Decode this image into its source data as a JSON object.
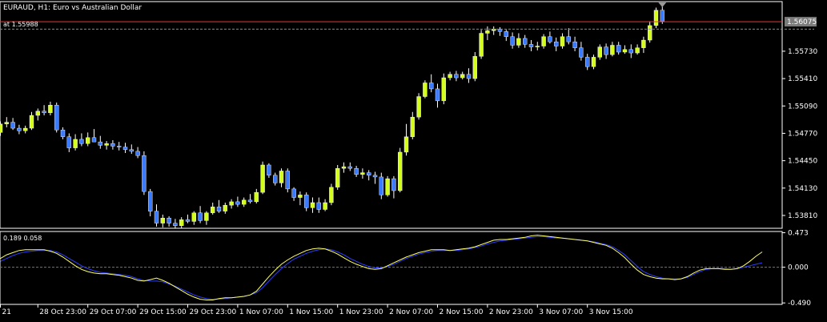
{
  "window": {
    "title": "EURAUD, H1:  Euro vs Australian Dollar",
    "alert_label": "at 1.55988"
  },
  "colors": {
    "background": "#000000",
    "bull": "#d4ff1c",
    "bear": "#3b7bff",
    "wick": "#ffffff",
    "axis": "#ffffff",
    "grid": "#777777",
    "alert_line": "#8a8a8a",
    "bid_line": "#ff2d2d",
    "price_tag_bg": "#7b7b7b",
    "osc_main": "#ffff66",
    "osc_signal": "#2d3dff"
  },
  "chart_data": [
    {
      "type": "candlestick",
      "title": "EURAUD, H1:  Euro vs Australian Dollar",
      "y_ticks": [
        1.5573,
        1.5541,
        1.5509,
        1.5477,
        1.5445,
        1.5413,
        1.5381
      ],
      "y_tick_labels": [
        "1.55730",
        "1.55410",
        "1.55090",
        "1.54770",
        "1.54450",
        "1.54130",
        "1.53810"
      ],
      "ylim": [
        1.5366,
        1.5631
      ],
      "current_price": 1.56075,
      "current_price_label": "1.56075",
      "alert_price": 1.55988,
      "x_ticks": [
        {
          "index": 0,
          "label": "21"
        },
        {
          "index": 6,
          "label": "28 Oct 23:00"
        },
        {
          "index": 14,
          "label": "29 Oct 07:00"
        },
        {
          "index": 22,
          "label": "29 Oct 15:00"
        },
        {
          "index": 30,
          "label": "29 Oct 23:00"
        },
        {
          "index": 38,
          "label": "1 Nov 07:00"
        },
        {
          "index": 46,
          "label": "1 Nov 15:00"
        },
        {
          "index": 54,
          "label": "1 Nov 23:00"
        },
        {
          "index": 62,
          "label": "2 Nov 07:00"
        },
        {
          "index": 70,
          "label": "2 Nov 15:00"
        },
        {
          "index": 78,
          "label": "2 Nov 23:00"
        },
        {
          "index": 86,
          "label": "3 Nov 07:00"
        },
        {
          "index": 94,
          "label": "3 Nov 15:00"
        }
      ],
      "candles": [
        [
          1.5478,
          1.5491,
          1.5474,
          1.5488
        ],
        [
          1.5488,
          1.5496,
          1.5484,
          1.549
        ],
        [
          1.549,
          1.5495,
          1.5481,
          1.5483
        ],
        [
          1.5483,
          1.5487,
          1.5476,
          1.548
        ],
        [
          1.548,
          1.5486,
          1.5477,
          1.5483
        ],
        [
          1.5483,
          1.5502,
          1.5481,
          1.5498
        ],
        [
          1.5498,
          1.5506,
          1.5492,
          1.5503
        ],
        [
          1.5503,
          1.551,
          1.5498,
          1.5501
        ],
        [
          1.5501,
          1.5514,
          1.5498,
          1.551
        ],
        [
          1.551,
          1.5513,
          1.5478,
          1.5481
        ],
        [
          1.5481,
          1.5484,
          1.547,
          1.5473
        ],
        [
          1.5473,
          1.5477,
          1.5455,
          1.546
        ],
        [
          1.546,
          1.5476,
          1.5457,
          1.547
        ],
        [
          1.547,
          1.5477,
          1.5462,
          1.5465
        ],
        [
          1.5465,
          1.5478,
          1.5462,
          1.5472
        ],
        [
          1.5472,
          1.5482,
          1.5467,
          1.5467
        ],
        [
          1.5467,
          1.5474,
          1.5459,
          1.5463
        ],
        [
          1.5463,
          1.5468,
          1.5458,
          1.5465
        ],
        [
          1.5465,
          1.5469,
          1.5458,
          1.5462
        ],
        [
          1.5462,
          1.5467,
          1.5457,
          1.5461
        ],
        [
          1.5461,
          1.5466,
          1.5454,
          1.5458
        ],
        [
          1.5458,
          1.5464,
          1.5453,
          1.5456
        ],
        [
          1.5456,
          1.5461,
          1.5448,
          1.5451
        ],
        [
          1.5451,
          1.5456,
          1.5405,
          1.5409
        ],
        [
          1.5409,
          1.5412,
          1.538,
          1.5386
        ],
        [
          1.5386,
          1.5394,
          1.5368,
          1.5372
        ],
        [
          1.5372,
          1.5382,
          1.5367,
          1.5378
        ],
        [
          1.5378,
          1.538,
          1.5368,
          1.5372
        ],
        [
          1.5372,
          1.5377,
          1.5366,
          1.5369
        ],
        [
          1.5369,
          1.5379,
          1.5366,
          1.5376
        ],
        [
          1.5376,
          1.5382,
          1.5372,
          1.5374
        ],
        [
          1.5374,
          1.5386,
          1.537,
          1.5384
        ],
        [
          1.5384,
          1.5392,
          1.5372,
          1.5375
        ],
        [
          1.5375,
          1.5386,
          1.537,
          1.5384
        ],
        [
          1.5384,
          1.5396,
          1.5382,
          1.5391
        ],
        [
          1.5391,
          1.5399,
          1.5384,
          1.5386
        ],
        [
          1.5386,
          1.5396,
          1.5383,
          1.5393
        ],
        [
          1.5393,
          1.54,
          1.5389,
          1.5397
        ],
        [
          1.5397,
          1.5403,
          1.5391,
          1.5394
        ],
        [
          1.5394,
          1.5402,
          1.5391,
          1.5399
        ],
        [
          1.5399,
          1.5406,
          1.5395,
          1.5397
        ],
        [
          1.5397,
          1.5412,
          1.5395,
          1.5408
        ],
        [
          1.5408,
          1.5444,
          1.5406,
          1.544
        ],
        [
          1.544,
          1.5442,
          1.5425,
          1.5428
        ],
        [
          1.5428,
          1.5431,
          1.5416,
          1.5419
        ],
        [
          1.5419,
          1.5436,
          1.5414,
          1.5433
        ],
        [
          1.5433,
          1.5436,
          1.5408,
          1.5412
        ],
        [
          1.5412,
          1.5414,
          1.5398,
          1.5402
        ],
        [
          1.5402,
          1.5409,
          1.5393,
          1.5405
        ],
        [
          1.5405,
          1.5408,
          1.5386,
          1.539
        ],
        [
          1.539,
          1.5402,
          1.5384,
          1.5396
        ],
        [
          1.5396,
          1.5402,
          1.5384,
          1.5388
        ],
        [
          1.5388,
          1.54,
          1.5386,
          1.5396
        ],
        [
          1.5396,
          1.5418,
          1.5393,
          1.5414
        ],
        [
          1.5414,
          1.544,
          1.5411,
          1.5436
        ],
        [
          1.5436,
          1.5443,
          1.5431,
          1.5438
        ],
        [
          1.5438,
          1.5443,
          1.5433,
          1.5436
        ],
        [
          1.5436,
          1.5439,
          1.5426,
          1.5429
        ],
        [
          1.5429,
          1.5436,
          1.5424,
          1.5431
        ],
        [
          1.5431,
          1.5434,
          1.5422,
          1.5428
        ],
        [
          1.5428,
          1.5432,
          1.5418,
          1.5426
        ],
        [
          1.5426,
          1.5431,
          1.54,
          1.5405
        ],
        [
          1.5405,
          1.5427,
          1.5403,
          1.5424
        ],
        [
          1.5424,
          1.5427,
          1.5401,
          1.541
        ],
        [
          1.541,
          1.546,
          1.5408,
          1.5455
        ],
        [
          1.5455,
          1.5488,
          1.5451,
          1.5473
        ],
        [
          1.5473,
          1.5502,
          1.547,
          1.5496
        ],
        [
          1.5496,
          1.5524,
          1.5493,
          1.552
        ],
        [
          1.552,
          1.5539,
          1.5518,
          1.5536
        ],
        [
          1.5536,
          1.5546,
          1.5525,
          1.5529
        ],
        [
          1.5529,
          1.5535,
          1.5507,
          1.5515
        ],
        [
          1.5515,
          1.5547,
          1.5511,
          1.5542
        ],
        [
          1.5542,
          1.5549,
          1.5539,
          1.5546
        ],
        [
          1.5546,
          1.555,
          1.5538,
          1.5542
        ],
        [
          1.5542,
          1.5549,
          1.554,
          1.5546
        ],
        [
          1.5546,
          1.5553,
          1.5536,
          1.5541
        ],
        [
          1.5541,
          1.5572,
          1.5538,
          1.5567
        ],
        [
          1.5567,
          1.5598,
          1.5564,
          1.5594
        ],
        [
          1.5594,
          1.5602,
          1.5586,
          1.5597
        ],
        [
          1.5597,
          1.5602,
          1.5592,
          1.5599
        ],
        [
          1.5599,
          1.5601,
          1.5591,
          1.5596
        ],
        [
          1.5596,
          1.5598,
          1.5585,
          1.559
        ],
        [
          1.559,
          1.5595,
          1.5576,
          1.558
        ],
        [
          1.558,
          1.5594,
          1.5577,
          1.5588
        ],
        [
          1.5588,
          1.5592,
          1.5577,
          1.5581
        ],
        [
          1.5581,
          1.5586,
          1.5573,
          1.5578
        ],
        [
          1.5578,
          1.5584,
          1.5574,
          1.5579
        ],
        [
          1.5579,
          1.5593,
          1.5576,
          1.559
        ],
        [
          1.559,
          1.5596,
          1.5582,
          1.5584
        ],
        [
          1.5584,
          1.5589,
          1.5573,
          1.5579
        ],
        [
          1.5579,
          1.5594,
          1.5576,
          1.559
        ],
        [
          1.559,
          1.56,
          1.5581,
          1.5584
        ],
        [
          1.5584,
          1.559,
          1.5573,
          1.5577
        ],
        [
          1.5577,
          1.5584,
          1.5562,
          1.5566
        ],
        [
          1.5566,
          1.557,
          1.5551,
          1.5555
        ],
        [
          1.5555,
          1.5569,
          1.5552,
          1.5566
        ],
        [
          1.5566,
          1.5581,
          1.5563,
          1.5578
        ],
        [
          1.5578,
          1.5582,
          1.5564,
          1.5569
        ],
        [
          1.5569,
          1.5584,
          1.5567,
          1.558
        ],
        [
          1.558,
          1.5584,
          1.5569,
          1.5572
        ],
        [
          1.5572,
          1.558,
          1.557,
          1.5575
        ],
        [
          1.5575,
          1.5581,
          1.5565,
          1.5571
        ],
        [
          1.5571,
          1.5581,
          1.5569,
          1.5577
        ],
        [
          1.5577,
          1.559,
          1.5571,
          1.5586
        ],
        [
          1.5586,
          1.5608,
          1.5583,
          1.5603
        ],
        [
          1.5603,
          1.5624,
          1.56,
          1.5621
        ],
        [
          1.5621,
          1.5627,
          1.5605,
          1.5608
        ]
      ]
    },
    {
      "type": "line",
      "header_label": "0.189 0.058",
      "y_ticks": [
        0.473,
        0.0,
        -0.49
      ],
      "y_tick_labels": [
        "0.473",
        "0.000",
        "-0.490"
      ],
      "ylim": [
        -0.51,
        0.49
      ],
      "series": [
        {
          "values": [
            0.12,
            0.17,
            0.2,
            0.23,
            0.24,
            0.24,
            0.24,
            0.24,
            0.22,
            0.19,
            0.14,
            0.08,
            0.02,
            -0.03,
            -0.06,
            -0.08,
            -0.09,
            -0.09,
            -0.1,
            -0.11,
            -0.13,
            -0.15,
            -0.18,
            -0.19,
            -0.17,
            -0.15,
            -0.18,
            -0.22,
            -0.27,
            -0.32,
            -0.37,
            -0.41,
            -0.44,
            -0.45,
            -0.45,
            -0.43,
            -0.42,
            -0.42,
            -0.41,
            -0.4,
            -0.38,
            -0.33,
            -0.23,
            -0.13,
            -0.04,
            0.04,
            0.1,
            0.15,
            0.19,
            0.23,
            0.25,
            0.26,
            0.25,
            0.22,
            0.18,
            0.13,
            0.08,
            0.04,
            0.01,
            -0.02,
            -0.03,
            -0.02,
            0.02,
            0.06,
            0.1,
            0.14,
            0.17,
            0.2,
            0.22,
            0.24,
            0.24,
            0.24,
            0.23,
            0.24,
            0.25,
            0.26,
            0.28,
            0.31,
            0.34,
            0.37,
            0.38,
            0.38,
            0.39,
            0.4,
            0.41,
            0.43,
            0.44,
            0.43,
            0.42,
            0.41,
            0.4,
            0.39,
            0.38,
            0.37,
            0.36,
            0.34,
            0.32,
            0.3,
            0.26,
            0.2,
            0.13,
            0.04,
            -0.04,
            -0.1,
            -0.13,
            -0.15,
            -0.16,
            -0.16,
            -0.17,
            -0.16,
            -0.13,
            -0.08,
            -0.04,
            -0.02,
            -0.02,
            -0.02,
            -0.03,
            -0.03,
            -0.02,
            0.02,
            0.08,
            0.15,
            0.21
          ]
        },
        {
          "values": [
            0.08,
            0.12,
            0.16,
            0.19,
            0.21,
            0.22,
            0.23,
            0.23,
            0.23,
            0.21,
            0.17,
            0.12,
            0.07,
            0.02,
            -0.02,
            -0.05,
            -0.07,
            -0.08,
            -0.09,
            -0.1,
            -0.11,
            -0.13,
            -0.16,
            -0.18,
            -0.19,
            -0.19,
            -0.2,
            -0.23,
            -0.26,
            -0.3,
            -0.34,
            -0.38,
            -0.41,
            -0.43,
            -0.44,
            -0.44,
            -0.43,
            -0.42,
            -0.41,
            -0.4,
            -0.38,
            -0.35,
            -0.28,
            -0.19,
            -0.1,
            -0.02,
            0.05,
            0.11,
            0.15,
            0.19,
            0.22,
            0.24,
            0.25,
            0.24,
            0.21,
            0.17,
            0.12,
            0.08,
            0.04,
            0.01,
            -0.01,
            -0.01,
            0.01,
            0.04,
            0.08,
            0.12,
            0.15,
            0.18,
            0.2,
            0.22,
            0.23,
            0.23,
            0.23,
            0.23,
            0.24,
            0.25,
            0.27,
            0.29,
            0.32,
            0.34,
            0.36,
            0.37,
            0.38,
            0.39,
            0.4,
            0.41,
            0.42,
            0.42,
            0.41,
            0.4,
            0.4,
            0.39,
            0.38,
            0.37,
            0.36,
            0.35,
            0.33,
            0.31,
            0.28,
            0.23,
            0.17,
            0.09,
            0.01,
            -0.06,
            -0.1,
            -0.13,
            -0.15,
            -0.16,
            -0.16,
            -0.16,
            -0.14,
            -0.1,
            -0.06,
            -0.03,
            -0.02,
            -0.02,
            -0.02,
            -0.03,
            -0.02,
            0.0,
            0.02,
            0.04,
            0.06
          ]
        }
      ]
    }
  ]
}
